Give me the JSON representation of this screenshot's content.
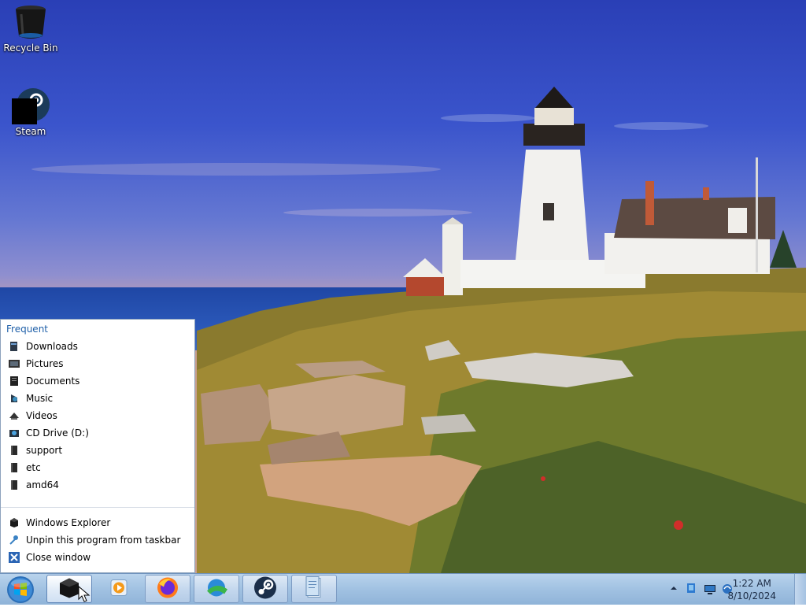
{
  "desktop": {
    "icons": [
      {
        "label": "Recycle Bin",
        "icon": "recycle-bin-icon"
      },
      {
        "label": "Steam",
        "icon": "steam-icon"
      }
    ]
  },
  "jumplist": {
    "header": "Frequent",
    "frequent": [
      {
        "label": "Downloads",
        "icon": "downloads-folder-icon"
      },
      {
        "label": "Pictures",
        "icon": "pictures-folder-icon"
      },
      {
        "label": "Documents",
        "icon": "documents-folder-icon"
      },
      {
        "label": "Music",
        "icon": "music-folder-icon"
      },
      {
        "label": "Videos",
        "icon": "videos-folder-icon"
      },
      {
        "label": "CD Drive (D:)",
        "icon": "cd-drive-icon"
      },
      {
        "label": "support",
        "icon": "folder-icon"
      },
      {
        "label": "etc",
        "icon": "folder-icon"
      },
      {
        "label": "amd64",
        "icon": "folder-icon"
      }
    ],
    "tasks": [
      {
        "label": "Windows Explorer",
        "icon": "explorer-icon"
      },
      {
        "label": "Unpin this program from taskbar",
        "icon": "unpin-icon"
      },
      {
        "label": "Close window",
        "icon": "close-icon"
      }
    ]
  },
  "taskbar": {
    "buttons": [
      {
        "name": "explorer",
        "icon": "explorer-icon",
        "active": true
      },
      {
        "name": "media-player",
        "icon": "media-player-icon"
      },
      {
        "name": "firefox",
        "icon": "firefox-icon"
      },
      {
        "name": "internet-download-manager",
        "icon": "download-manager-icon"
      },
      {
        "name": "steam",
        "icon": "steam-icon"
      },
      {
        "name": "notepad",
        "icon": "notepad-icon"
      }
    ],
    "tray": {
      "icons": [
        "show-hidden-icons",
        "network-icon",
        "display-icon",
        "volume-icon"
      ],
      "time": "1:22 AM",
      "date": "8/10/2024"
    }
  },
  "colors": {
    "taskbar": "#a3c3e3",
    "jumplist_header": "#1e5fa8"
  }
}
